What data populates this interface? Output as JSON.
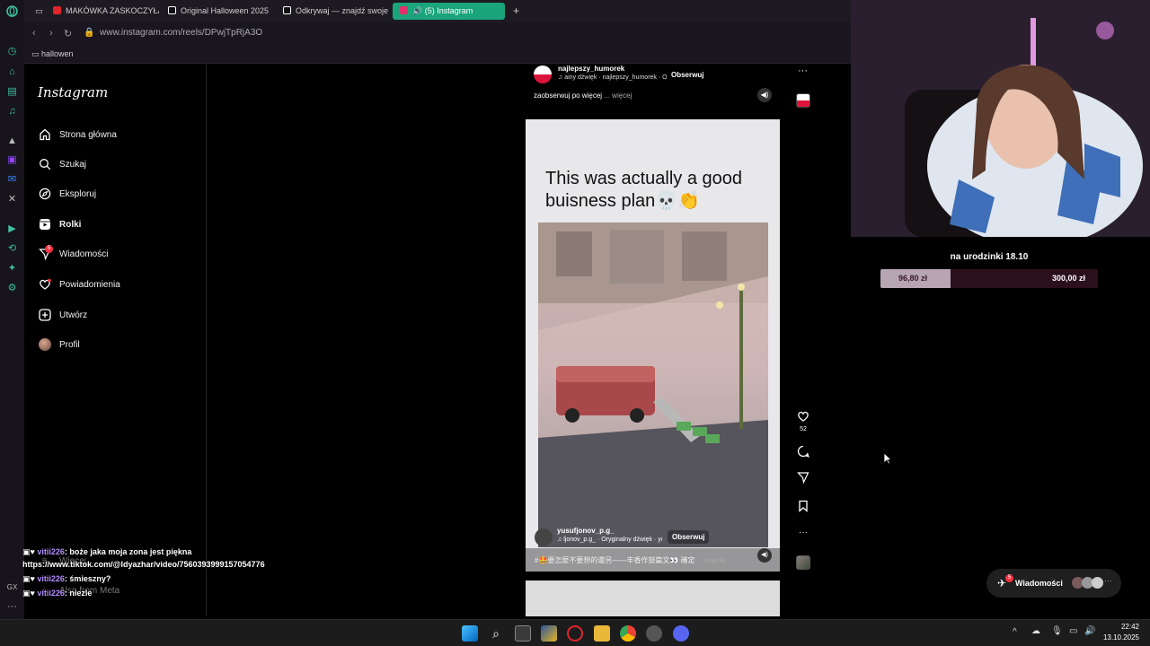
{
  "browser": {
    "tabs": [
      {
        "label": "MAKÓWKA ZASKOCZYŁA",
        "color": "#e0252b"
      },
      {
        "label": "Original Halloween 2025",
        "color": "#ffffff"
      },
      {
        "label": "Odkrywaj — znajdź swoje",
        "color": "#ffffff"
      },
      {
        "label": "(5) Instagram",
        "color": "#e1306c"
      }
    ],
    "new_tab": "+",
    "url": "www.instagram.com/reels/DPwjTpRjA3O",
    "bookmark": "hallowen"
  },
  "instagram": {
    "logo": "Instagram",
    "nav": [
      {
        "label": "Strona główna",
        "icon": "home-icon"
      },
      {
        "label": "Szukaj",
        "icon": "search-icon"
      },
      {
        "label": "Eksploruj",
        "icon": "compass-icon"
      },
      {
        "label": "Rolki",
        "icon": "reels-icon"
      },
      {
        "label": "Wiadomości",
        "icon": "messenger-icon",
        "badge": "5"
      },
      {
        "label": "Powiadomienia",
        "icon": "heart-icon"
      },
      {
        "label": "Utwórz",
        "icon": "plus-icon"
      },
      {
        "label": "Profil",
        "icon": "avatar-icon"
      }
    ],
    "more": "Więcej",
    "also_from_meta": "Also from Meta"
  },
  "reel": {
    "author": "najlepszy_humorek",
    "audio": "ainy dźwięk · najlepszy_humorek · O",
    "follow": "Obserwuj",
    "description": "zaobserwuj po więcej",
    "more": "... więcej",
    "caption": "This was actually a good buisness plan💀👏",
    "inner_author": "yusufjonov_p.g_",
    "inner_audio": "ljonov_p.g_ · Oryginalny dźwięk · yı",
    "inner_follow": "Obserwuj",
    "inner_description": "#🤩要怎麼不要想的還另——丰香作鼓篇文👀 確定",
    "likes": "52"
  },
  "chat": [
    {
      "user": "vitii226",
      "text": ": boże jaka moja zona jest piękna"
    },
    {
      "user": "",
      "text": "https://www.tiktok.com/@ldyazhar/video/7560393999157054776"
    },
    {
      "user": "vitii226",
      "text": ": śmieszny?"
    },
    {
      "user": "vitii226",
      "text": ": niezle"
    }
  ],
  "stream": {
    "goal_title": "na urodzinki 18.10",
    "goal_current": "96,80 zł",
    "goal_target": "300,00 zł",
    "goal_progress": 0.3227,
    "messages_label": "Wiadomości",
    "messages_badge": "5"
  },
  "taskbar": {
    "time": "22:42",
    "date": "13.10.2025",
    "tray_label": "^"
  },
  "opera": {
    "gx": "GX",
    "more": "···"
  }
}
